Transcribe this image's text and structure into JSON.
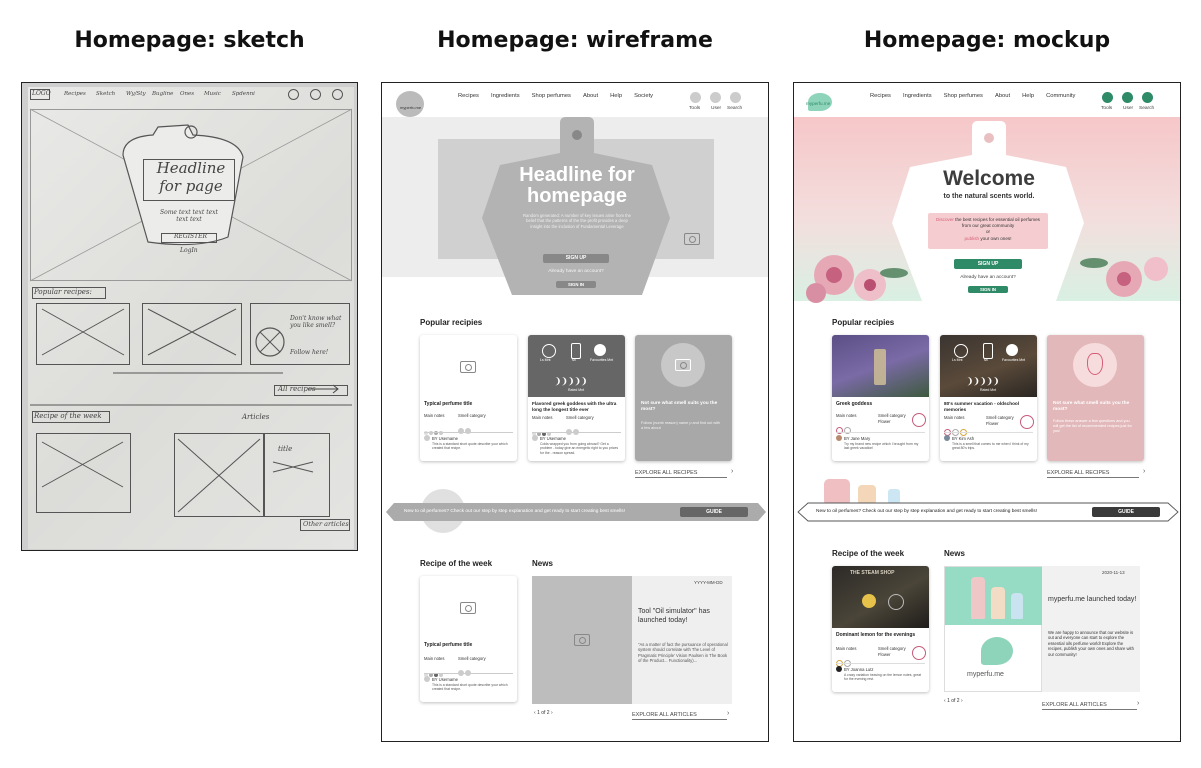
{
  "titles": {
    "sketch": "Homepage: sketch",
    "wireframe": "Homepage: wireframe",
    "mockup": "Homepage: mockup"
  },
  "sketch": {
    "logo": "LOGO",
    "nav": [
      "Recipes",
      "Sketch",
      "Wy/Sty",
      "Bugline",
      "Ones",
      "Music",
      "Spdenni"
    ],
    "headline": "Headline for page",
    "subtext": "Some text text text text text",
    "register": "REGISTER",
    "login": "LogIn",
    "popular": "Popular recipes:",
    "dont_know": "Don't know what you like smell?",
    "follow": "Follow here!",
    "all_recipes": "All recipes",
    "recipe_week": "Recipe of the week",
    "articles": "Articles",
    "title": "title",
    "other": "Other articles"
  },
  "wireframe": {
    "logo": "myperfu.me",
    "nav": [
      "Recipes",
      "Ingredients",
      "Shop perfumes",
      "About",
      "Help",
      "Society"
    ],
    "icons": [
      "Tools",
      "User",
      "Search"
    ],
    "headline": "Headline for homepage",
    "lorem": "Random generated: A number of key issues arise from the belief that the patterns of the the-profit provides a deep insight into the inclusion of Fundamental Leverage",
    "signup": "SIGN UP",
    "already": "Already have an account?",
    "signin": "SIGN IN",
    "popular": "Popular recipies",
    "card1_title": "Typical perfume title",
    "card2_title": "Flavored greek goddess with the ultra long the longest title ever",
    "main_notes": "Main notes",
    "smell_category": "Smell category",
    "by_user": "BY Username",
    "card1_desc": "This is a standard short quote describe your which created that recipe.",
    "card2_desc": "Colds wrapped you from going abroad? Get a problem - today give an energetic right to you prices for the - reason spread.",
    "not_sure": "Not sure what smell suits you the most?",
    "follow_text": "Follow (numb reason) name p and find out with a few about",
    "explore_recipes": "EXPLORE ALL RECIPES",
    "guide_text": "New to oil perfumes? Check out our step by step explanation and get ready to start creating best smells!",
    "guide": "GUIDE",
    "recipe_week": "Recipe of the week",
    "news": "News",
    "date": "YYYY-MM-DD",
    "news_title": "Tool \"Oil simulator\" has launched today!",
    "news_body": "\"As a matter of fact the pursuance of operational system should correlate with The Level of Pragmatic Principle' Vision Paulsen in The Book of the Product... Functionality)...",
    "week_title": "Typical perfume title",
    "week_desc": "This is a standard short quote describe your which created that recipe.",
    "pager": "1 of 2",
    "explore_articles": "EXPLORE ALL ARTICLES",
    "stats": [
      "Ls Mnt",
      "Ml",
      "Favourites Mnt",
      "Rated Mnt"
    ]
  },
  "mockup": {
    "logo": "myperfu.me",
    "nav": [
      "Recipes",
      "Ingredients",
      "Shop perfumes",
      "About",
      "Help",
      "Community"
    ],
    "icons": [
      "Tools",
      "User",
      "Search"
    ],
    "welcome": "Welcome",
    "sub": "to the natural scents world.",
    "discover1": "Discover",
    "discover2": " the best recipes for essential oil perfumes from our great community",
    "discover3": "or",
    "discover4": "publish",
    "discover5": " your own ones!",
    "signup": "SIGN UP",
    "already": "Already have an account?",
    "signin": "SIGN IN",
    "popular": "Popular recipies",
    "card1_title": "Greek goddess",
    "card2_title": "80's summer vacation - oldschool memories",
    "main_notes": "Main notes",
    "smell_category": "Smell category",
    "category_val": "Flower",
    "by_user1": "BY Jane Mary",
    "by_user2": "BY Kim Ash",
    "card1_desc": "Try my brand new recipe which I brought from my last greek vacation!",
    "card2_desc": "This is a smell that comes to me when I think of my great 80's trips.",
    "not_sure": "Not sure what smell suits you the most?",
    "follow_text": "Follow these answer a few questions and you will get the list of recommended recipes just for you!",
    "explore_recipes": "EXPLORE ALL RECIPES",
    "guide_text": "New to oil perfumes? Check out our step by step explanation and get ready to start creating best smells!",
    "guide": "GUIDE",
    "recipe_week": "Recipe of the week",
    "news": "News",
    "week_title": "Dominant lemon for the evenings",
    "week_user": "BY Joanna Lutz",
    "week_desc": "A crazy variation heaving on the lemon notes, great for the evening rest.",
    "date": "2020-11-13",
    "news_title": "myperfu.me launched today!",
    "news_body": "We are happy to announce that our website is out and everyone can start to explore the essential oils perfume world! Explore the recipes, publish your own ones and share with our community!",
    "news_logo": "myperfu.me",
    "pager": "1 of 2",
    "explore_articles": "EXPLORE ALL ARTICLES",
    "shop_sign": "THE STEAM SHOP",
    "stats": [
      "Ls Mnt",
      "Ml",
      "Favourites Mnt",
      "Rated Mnt"
    ],
    "colors": {
      "accent": "#2f8a68",
      "pink": "#e9bfc1",
      "mint": "#8ed4bb"
    }
  }
}
